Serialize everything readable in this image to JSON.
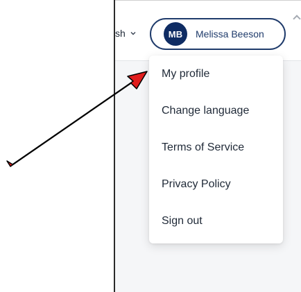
{
  "header": {
    "language_fragment": "sh",
    "user": {
      "initials": "MB",
      "name": "Melissa Beeson"
    }
  },
  "menu": {
    "items": [
      {
        "label": "My profile"
      },
      {
        "label": "Change language"
      },
      {
        "label": "Terms of Service"
      },
      {
        "label": "Privacy Policy"
      },
      {
        "label": "Sign out"
      }
    ]
  },
  "colors": {
    "avatar_bg": "#0f2c63",
    "pill_border": "#1f3b6b",
    "arrow_fill": "#e11d1d",
    "arrow_outline": "#000000"
  },
  "icons": {
    "language_chevron": "chevron-down-icon",
    "annotation": "red-arrow-icon"
  }
}
